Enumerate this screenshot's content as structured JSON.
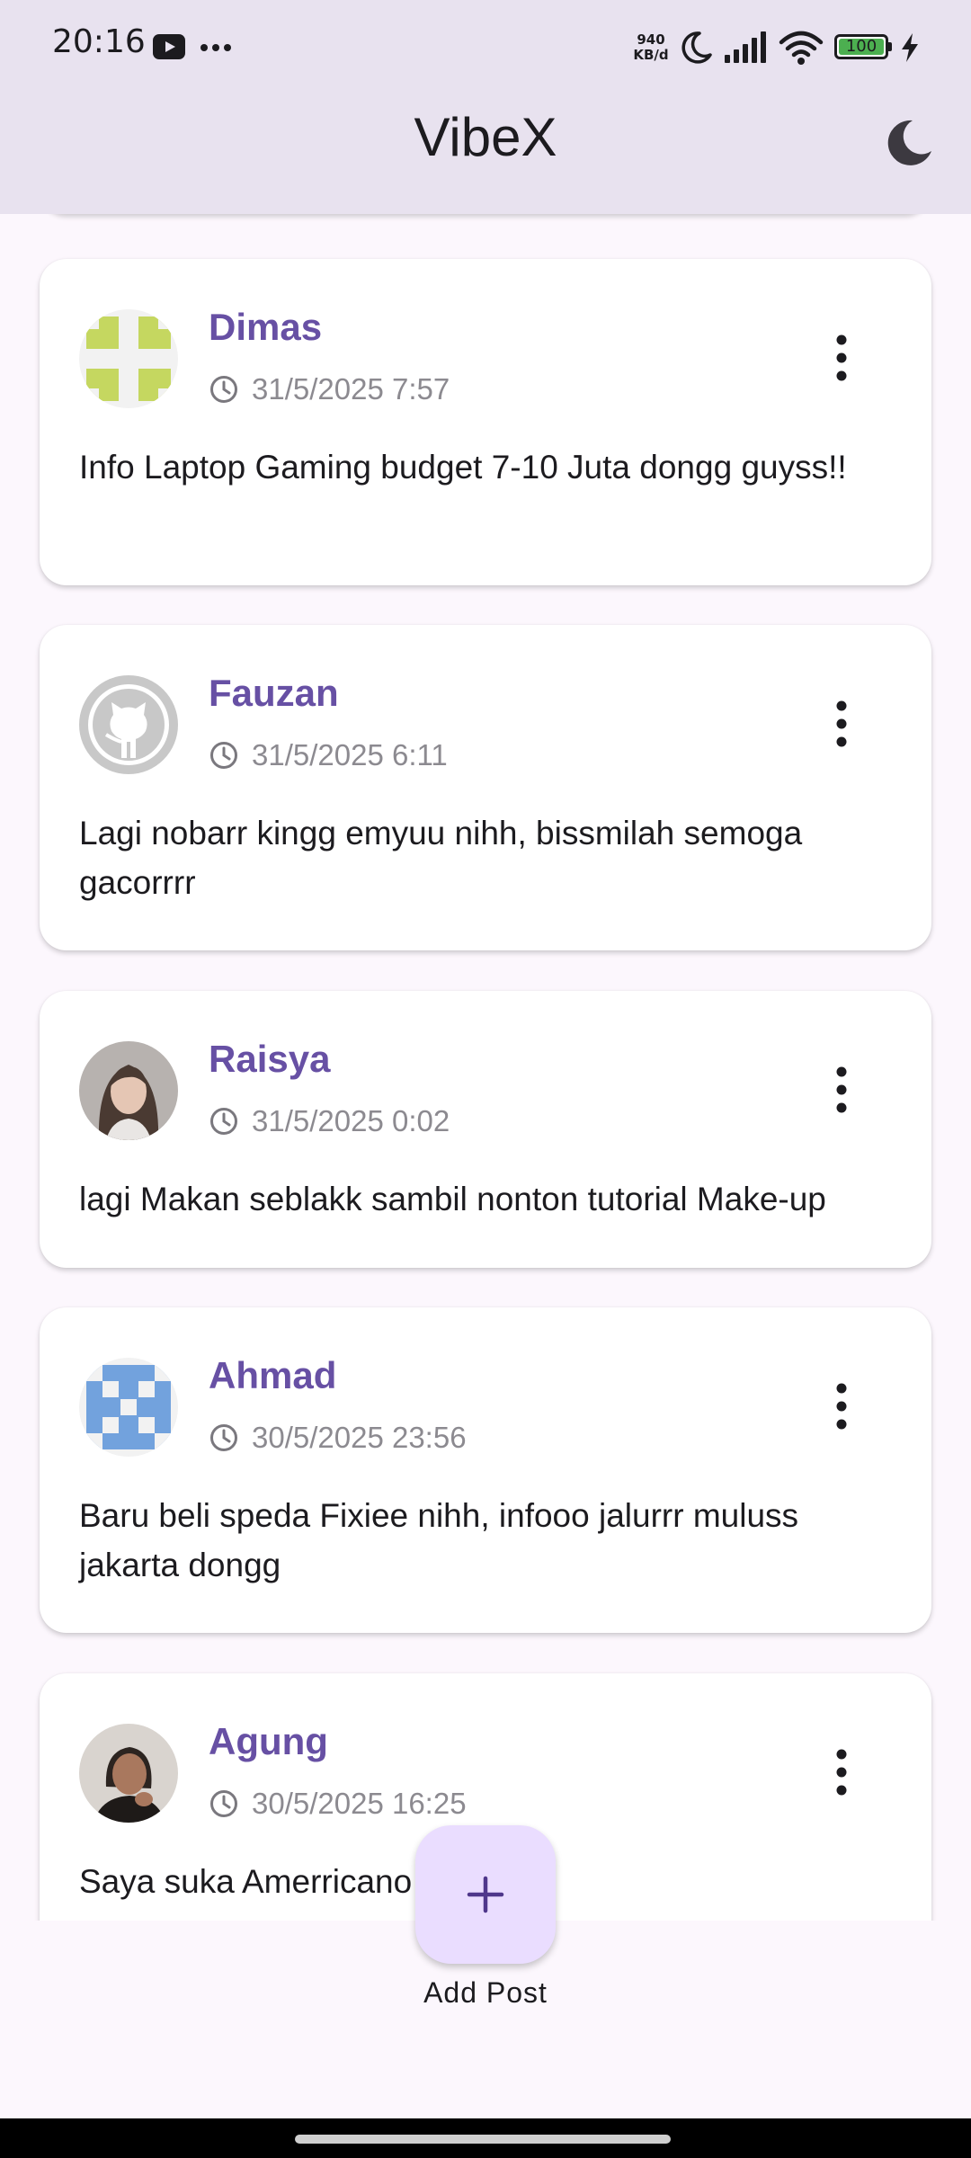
{
  "status_bar": {
    "time": "20:16",
    "speed_value": "940",
    "speed_unit": "KB/d",
    "battery": "100"
  },
  "app_bar": {
    "title": "VibeX"
  },
  "posts": [
    {
      "username": "Dimas",
      "timestamp": "31/5/2025 7:57",
      "text": "Info Laptop Gaming budget 7-10 Juta dongg guyss!!",
      "avatar_color": "#C5D760"
    },
    {
      "username": "Fauzan",
      "timestamp": "31/5/2025 6:11",
      "text": "Lagi nobarr kingg emyuu nihh, bissmilah semoga gacorrrr",
      "avatar_color": "#C8C8C8"
    },
    {
      "username": "Raisya",
      "timestamp": "31/5/2025 0:02",
      "text": "lagi Makan seblakk sambil nonton tutorial Make-up",
      "avatar_color": "#8B7B74"
    },
    {
      "username": "Ahmad",
      "timestamp": "30/5/2025 23:56",
      "text": "Baru beli speda Fixiee nihh, infooo jalurrr muluss jakarta dongg",
      "avatar_color": "#72A2DD"
    },
    {
      "username": "Agung",
      "timestamp": "30/5/2025 16:25",
      "text": "Saya suka Amerricano",
      "avatar_color": "#5C4A40"
    }
  ],
  "fab": {
    "label": "Add Post"
  },
  "colors": {
    "accent": "#6750A4",
    "app_bar": "#E8E2EF",
    "background": "#FCF7FD",
    "fab": "#EADDFF"
  }
}
